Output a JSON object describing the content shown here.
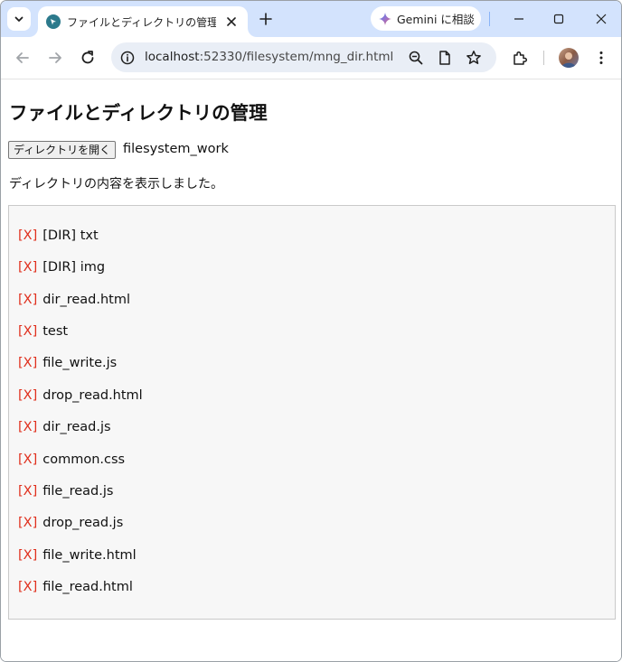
{
  "browser": {
    "tab_title": "ファイルとディレクトリの管理",
    "url_host": "localhost",
    "url_rest": ":52330/filesystem/mng_dir.html",
    "gemini_label": "Gemini に相談"
  },
  "page": {
    "title": "ファイルとディレクトリの管理",
    "open_button_label": "ディレクトリを開く",
    "directory_name": "filesystem_work",
    "status": "ディレクトリの内容を表示しました。",
    "delete_marker": "[X]",
    "entries": [
      "[DIR] txt",
      "[DIR] img",
      "dir_read.html",
      "test",
      "file_write.js",
      "drop_read.html",
      "dir_read.js",
      "common.css",
      "file_read.js",
      "drop_read.js",
      "file_write.html",
      "file_read.html"
    ]
  },
  "colors": {
    "tabstrip_bg": "#d3e3fd",
    "delete_link": "#e0301e",
    "list_bg": "#f7f7f7"
  }
}
